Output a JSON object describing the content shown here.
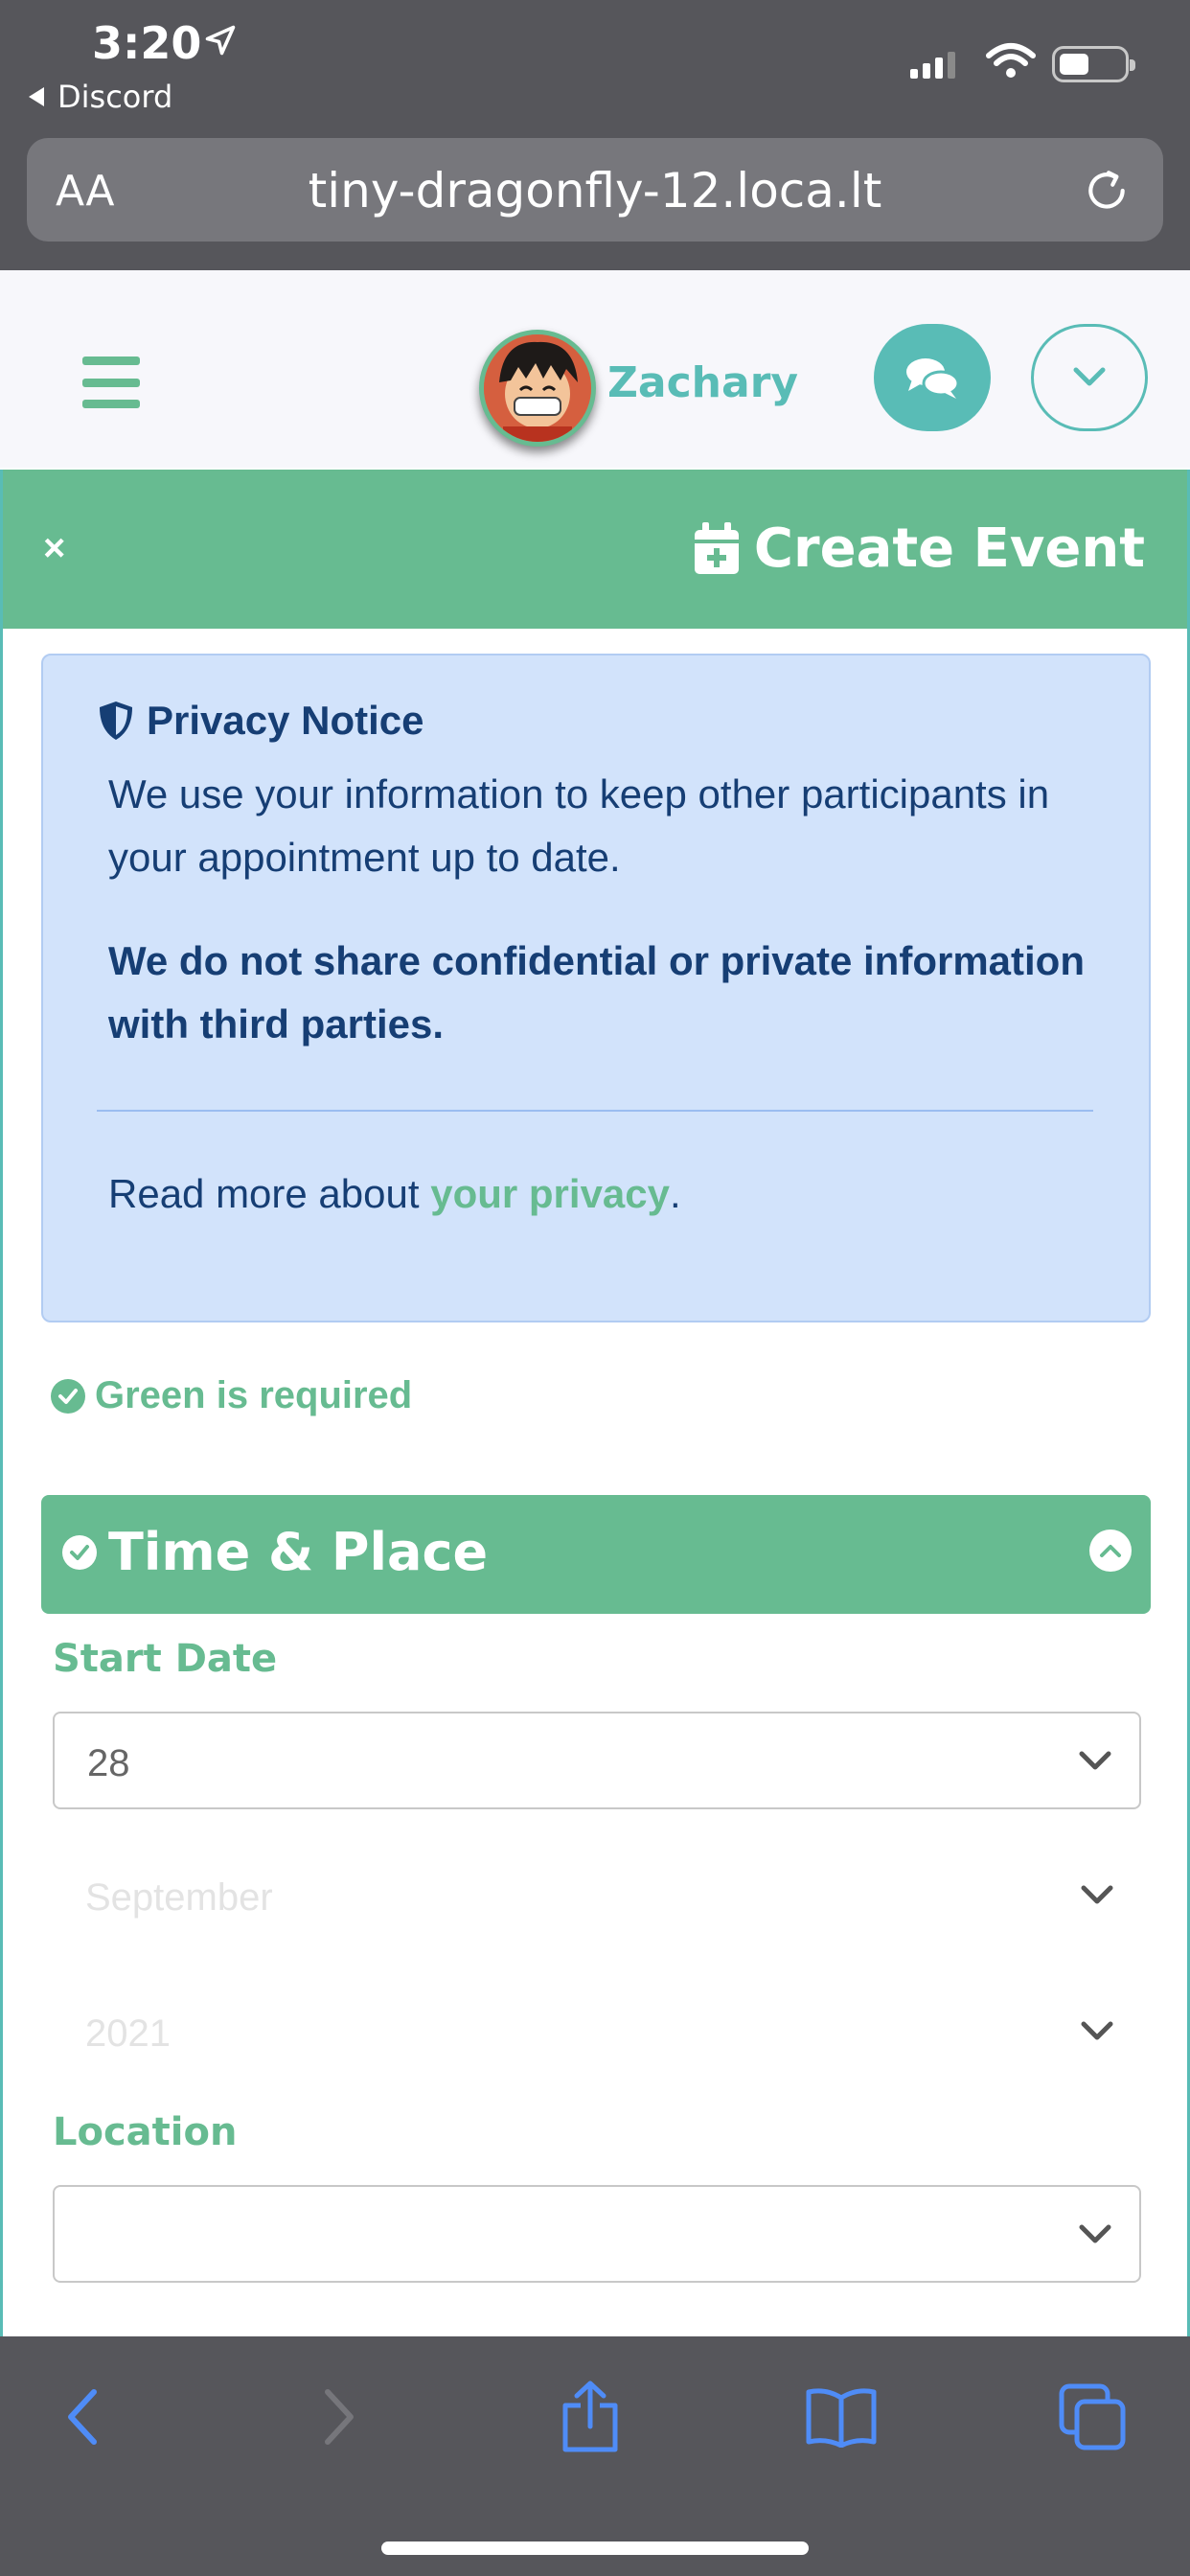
{
  "status_bar": {
    "time": "3:20",
    "back_app": "Discord"
  },
  "safari": {
    "aa_label": "AA",
    "url": "tiny-dragonfly-12.loca.lt"
  },
  "nav": {
    "user_name": "Zachary"
  },
  "modal": {
    "close_label": "×",
    "title": "Create Event"
  },
  "privacy": {
    "title": "Privacy Notice",
    "paragraph1": "We use your information to keep other participants in your appointment up to date.",
    "paragraph2": "We do not share confidential or private information with third parties.",
    "read_more_prefix": "Read more about ",
    "read_more_link": "your privacy",
    "read_more_suffix": "."
  },
  "required_note": "Green is required",
  "section": {
    "title": "Time & Place"
  },
  "form": {
    "start_date_label": "Start Date",
    "day_value": "28",
    "month_value": "September",
    "year_value": "2021",
    "location_label": "Location",
    "location_value": ""
  },
  "colors": {
    "accent_green": "#67bb91",
    "teal": "#59bcb6",
    "notice_bg": "#d2e3fb",
    "notice_text": "#163e74",
    "ios_chrome": "#56565b",
    "ios_blue": "#4f8cf7"
  },
  "icons": {
    "location_arrow": "location-arrow-icon",
    "menu": "hamburger-menu-icon",
    "chat": "chat-bubbles-icon",
    "dropdown": "chevron-down-icon",
    "calendar_plus": "calendar-plus-icon",
    "shield": "shield-icon",
    "check_circle": "check-circle-icon",
    "collapse": "chevron-up-circle-icon"
  }
}
